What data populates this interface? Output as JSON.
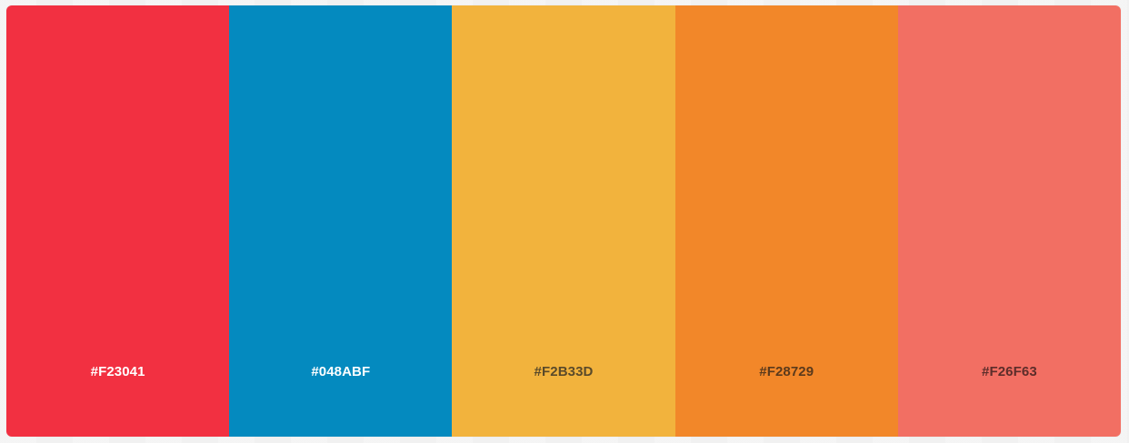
{
  "palette": {
    "swatches": [
      {
        "hex": "#F23041",
        "color": "#F23041",
        "text_color": "#FFFFFF"
      },
      {
        "hex": "#048ABF",
        "color": "#048ABF",
        "text_color": "#FFFFFF"
      },
      {
        "hex": "#F2B33D",
        "color": "#F2B33D",
        "text_color": "#5A4A2A"
      },
      {
        "hex": "#F28729",
        "color": "#F28729",
        "text_color": "#5B3A1C"
      },
      {
        "hex": "#F26F63",
        "color": "#F26F63",
        "text_color": "#5C2D2A"
      }
    ]
  }
}
